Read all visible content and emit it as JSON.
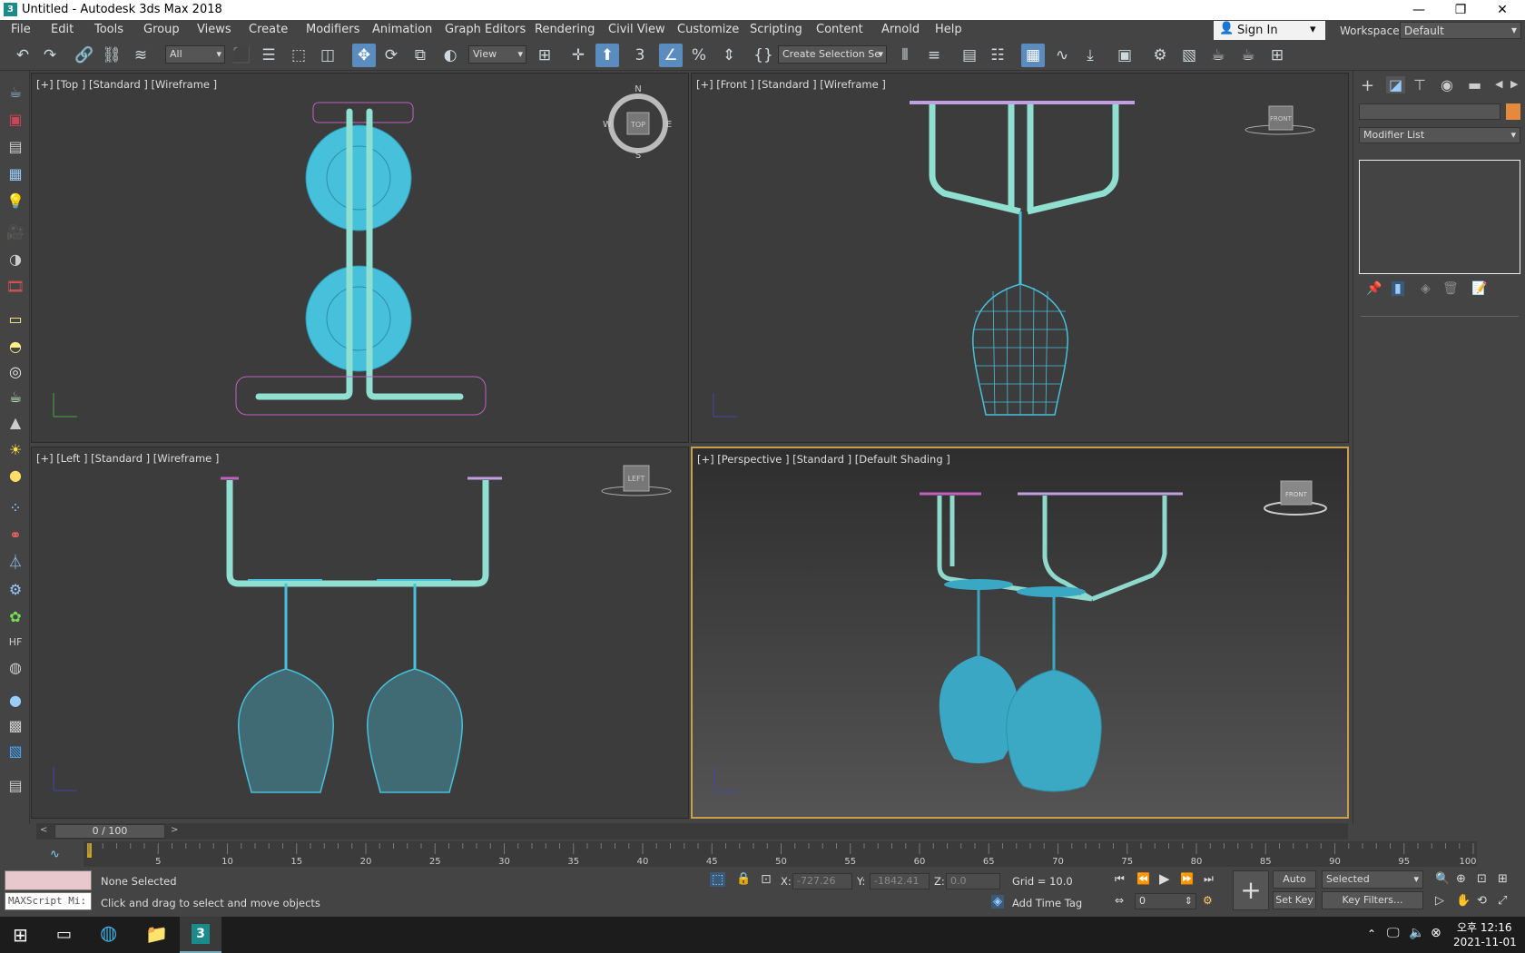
{
  "window": {
    "title": "Untitled - Autodesk 3ds Max 2018",
    "app_icon": "3",
    "minimize": "—",
    "restore": "❐",
    "close": "✕"
  },
  "menu": [
    "File",
    "Edit",
    "Tools",
    "Group",
    "Views",
    "Create",
    "Modifiers",
    "Animation",
    "Graph Editors",
    "Rendering",
    "Civil View",
    "Customize",
    "Scripting",
    "Content",
    "Arnold",
    "Help"
  ],
  "signin": {
    "label": "Sign In"
  },
  "workspaces": {
    "label": "Workspaces:",
    "value": "Default"
  },
  "toolbar": {
    "selection_filter": "All",
    "ref_coord": "View",
    "named_selection": "Create Selection Se",
    "snaps_label": "3"
  },
  "viewports": {
    "top": {
      "label": "[+] [Top ] [Standard ] [Wireframe ]",
      "compass": {
        "n": "N",
        "s": "S",
        "e": "E",
        "w": "W",
        "cube": "TOP"
      }
    },
    "front": {
      "label": "[+] [Front ] [Standard ] [Wireframe ]",
      "cube": "FRONT"
    },
    "left": {
      "label": "[+] [Left ] [Standard ] [Wireframe ]",
      "cube": "LEFT"
    },
    "perspective": {
      "label": "[+] [Perspective ] [Standard ] [Default Shading ]",
      "cube": "FRONT"
    }
  },
  "command_panel": {
    "modifier_list": "Modifier List"
  },
  "timeline": {
    "frame_display": "0 / 100",
    "ticks": [
      "5",
      "10",
      "15",
      "20",
      "25",
      "30",
      "35",
      "40",
      "45",
      "50",
      "55",
      "60",
      "65",
      "70",
      "75",
      "80",
      "85",
      "90",
      "95",
      "100"
    ]
  },
  "status": {
    "maxscript": "MAXScript Mi:",
    "selection": "None Selected",
    "prompt": "Click and drag to select and move objects",
    "x_label": "X:",
    "x_value": "-727.26",
    "y_label": "Y:",
    "y_value": "-1842.41",
    "z_label": "Z:",
    "z_value": "0.0",
    "grid": "Grid = 10.0",
    "add_time_tag": "Add Time Tag",
    "auto_key": "Auto Key",
    "set_key": "Set Key",
    "key_mode": "Selected",
    "key_filters": "Key Filters...",
    "frame_value": "0"
  },
  "taskbar": {
    "time": "오후 12:16",
    "date": "2021-11-01"
  },
  "colors": {
    "mesh": "#47c0dc",
    "rack": "#8fe0d0",
    "selection": "#c060c0",
    "accent_orange": "#e5893c"
  }
}
